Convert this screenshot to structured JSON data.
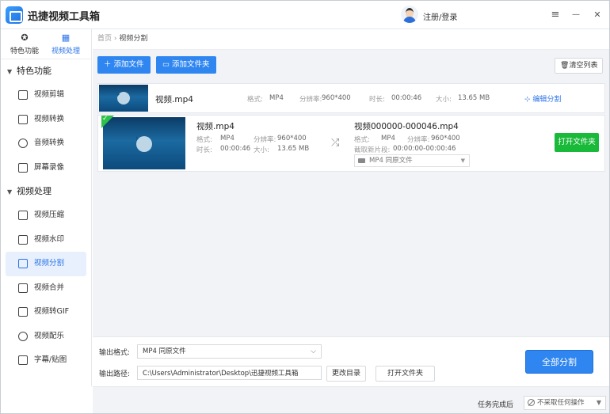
{
  "app": {
    "title": "迅捷视频工具箱",
    "login": "注册/登录"
  },
  "window": {
    "menu_icon": "≡",
    "minimize_icon": "—",
    "close_icon": "✕"
  },
  "sidebar": {
    "tabs": [
      {
        "label": "特色功能",
        "icon": "star-icon"
      },
      {
        "label": "视频处理",
        "icon": "film-icon",
        "active": true
      }
    ],
    "sections": [
      {
        "label": "特色功能",
        "items": [
          "视频剪辑",
          "视频转换",
          "音频转换",
          "屏幕录像"
        ]
      },
      {
        "label": "视频处理",
        "items": [
          "视频压缩",
          "视频水印",
          "视频分割",
          "视频合并",
          "视频转GIF",
          "视频配乐",
          "字幕/贴图"
        ]
      }
    ],
    "active_item": "视频分割"
  },
  "breadcrumb": {
    "home": "首页",
    "sep": "›",
    "current": "视频分割"
  },
  "toolbar": {
    "add_file": "添加文件",
    "add_folder": "添加文件夹",
    "clear_list": "清空列表"
  },
  "file": {
    "name": "视频.mp4",
    "format_label": "格式:",
    "format": "MP4",
    "resolution_label": "分辨率:",
    "resolution": "960*400",
    "duration_label": "时长:",
    "duration": "00:00:46",
    "size_label": "大小:",
    "size": "13.65 MB",
    "edit_split": "编辑分割"
  },
  "segment": {
    "source": {
      "name": "视频.mp4",
      "format_label": "格式:",
      "format": "MP4",
      "resolution_label": "分辨率:",
      "resolution": "960*400",
      "duration_label": "时长:",
      "duration": "00:00:46",
      "size_label": "大小:",
      "size": "13.65 MB"
    },
    "output": {
      "name": "视频000000-000046.mp4",
      "format_label": "格式:",
      "format": "MP4",
      "resolution_label": "分辨率:",
      "resolution": "960*400",
      "clip_label": "截取新片段:",
      "clip": "00:00:00-00:00:46",
      "format_select": "MP4  同原文件"
    },
    "open_folder": "打开文件夹"
  },
  "output_settings": {
    "format_label": "输出格式:",
    "format_value": "MP4  同原文件",
    "path_label": "输出路径:",
    "path_value": "C:\\Users\\Administrator\\Desktop\\迅捷视频工具箱",
    "change_dir": "更改目录",
    "open_folder": "打开文件夹",
    "split_all": "全部分割"
  },
  "status": {
    "on_complete_label": "任务完成后",
    "on_complete_value": "不采取任何操作"
  },
  "colors": {
    "accent": "#2f86f0",
    "success": "#19b93a"
  }
}
